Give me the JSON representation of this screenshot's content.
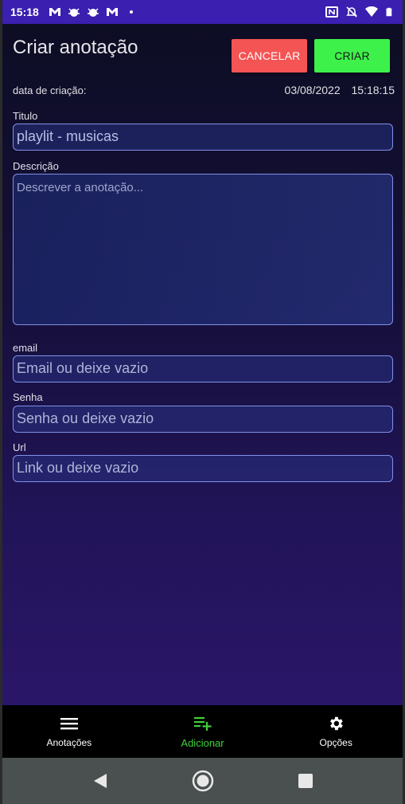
{
  "status_bar": {
    "time": "15:18",
    "notification_icons": [
      "gmail-icon",
      "bug-icon",
      "bug-icon",
      "gmail-icon",
      "dot-icon"
    ],
    "right_icons": [
      "nfc-icon",
      "mute-icon",
      "wifi-icon",
      "battery-icon"
    ]
  },
  "header": {
    "title": "Criar anotação",
    "cancel_label": "CANCELAR",
    "create_label": "CRIAR"
  },
  "creation": {
    "label": "data de criação:",
    "datetime": "03/08/2022   15:18:15"
  },
  "form": {
    "title_label": "Titulo",
    "title_value": "playlit - musicas",
    "description_label": "Descrição",
    "description_placeholder": "Descrever a anotação...",
    "email_label": "email",
    "email_placeholder": "Email ou deixe vazio",
    "password_label": "Senha",
    "password_placeholder": "Senha ou deixe vazio",
    "url_label": "Url",
    "url_placeholder": "Link ou deixe vazio"
  },
  "bottom_nav": {
    "items": [
      {
        "label": "Anotações",
        "icon": "menu-icon"
      },
      {
        "label": "Adicionar",
        "icon": "playlist-add-icon",
        "active": true
      },
      {
        "label": "Opções",
        "icon": "gear-icon"
      }
    ]
  },
  "colors": {
    "status_bar": "#3a1fb0",
    "cancel": "#f45454",
    "create": "#3ef04a",
    "active_nav": "#3ed13a",
    "field_border": "#8090e8"
  }
}
